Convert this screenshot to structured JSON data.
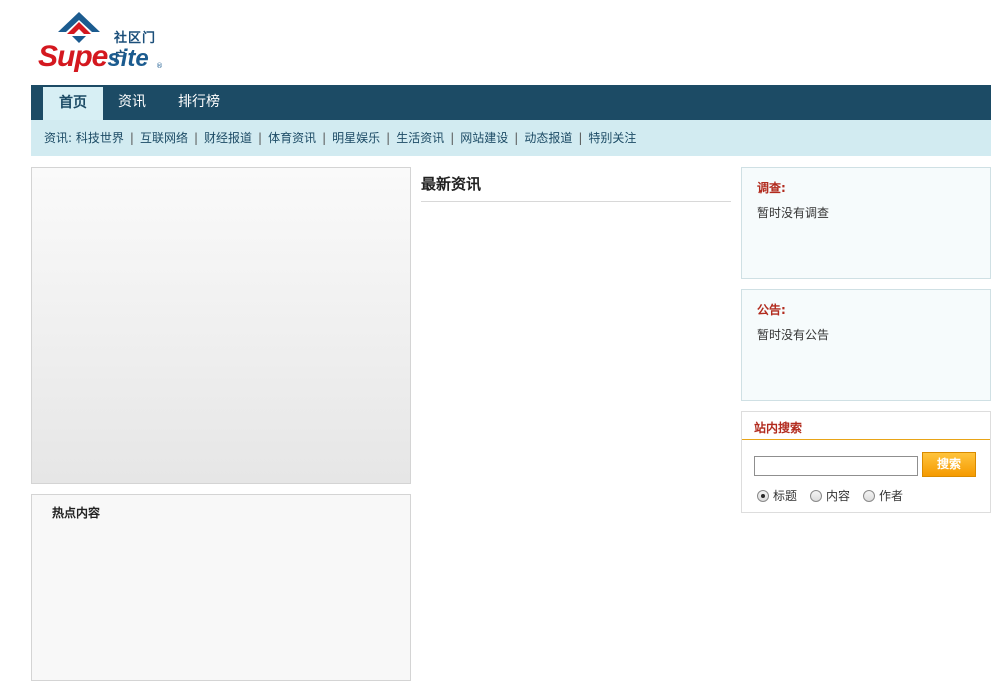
{
  "logo": {
    "cn_text": "社区门户",
    "en_supe": "Supe",
    "en_site": "site",
    "reg_mark": "®"
  },
  "nav": {
    "items": [
      {
        "label": "首页",
        "active": true
      },
      {
        "label": "资讯",
        "active": false
      },
      {
        "label": "排行榜",
        "active": false
      }
    ]
  },
  "subnav": {
    "lead": "资讯:",
    "items": [
      "科技世界",
      "互联网络",
      "财经报道",
      "体育资讯",
      "明星娱乐",
      "生活资讯",
      "网站建设",
      "动态报道",
      "特别关注"
    ]
  },
  "hot": {
    "title": "热点内容"
  },
  "news": {
    "title": "最新资讯"
  },
  "survey": {
    "title": "调查:",
    "text": "暂时没有调查"
  },
  "notice": {
    "title": "公告:",
    "text": "暂时没有公告"
  },
  "search": {
    "title": "站内搜索",
    "input_value": "",
    "button_label": "搜索",
    "options": [
      {
        "label": "标题",
        "checked": true
      },
      {
        "label": "内容",
        "checked": false
      },
      {
        "label": "作者",
        "checked": false
      }
    ]
  },
  "colors": {
    "nav_bg": "#1c4b65",
    "subnav_bg": "#d2ebf1",
    "title_red": "#b22b1e",
    "button_orange": "#f59a00"
  }
}
